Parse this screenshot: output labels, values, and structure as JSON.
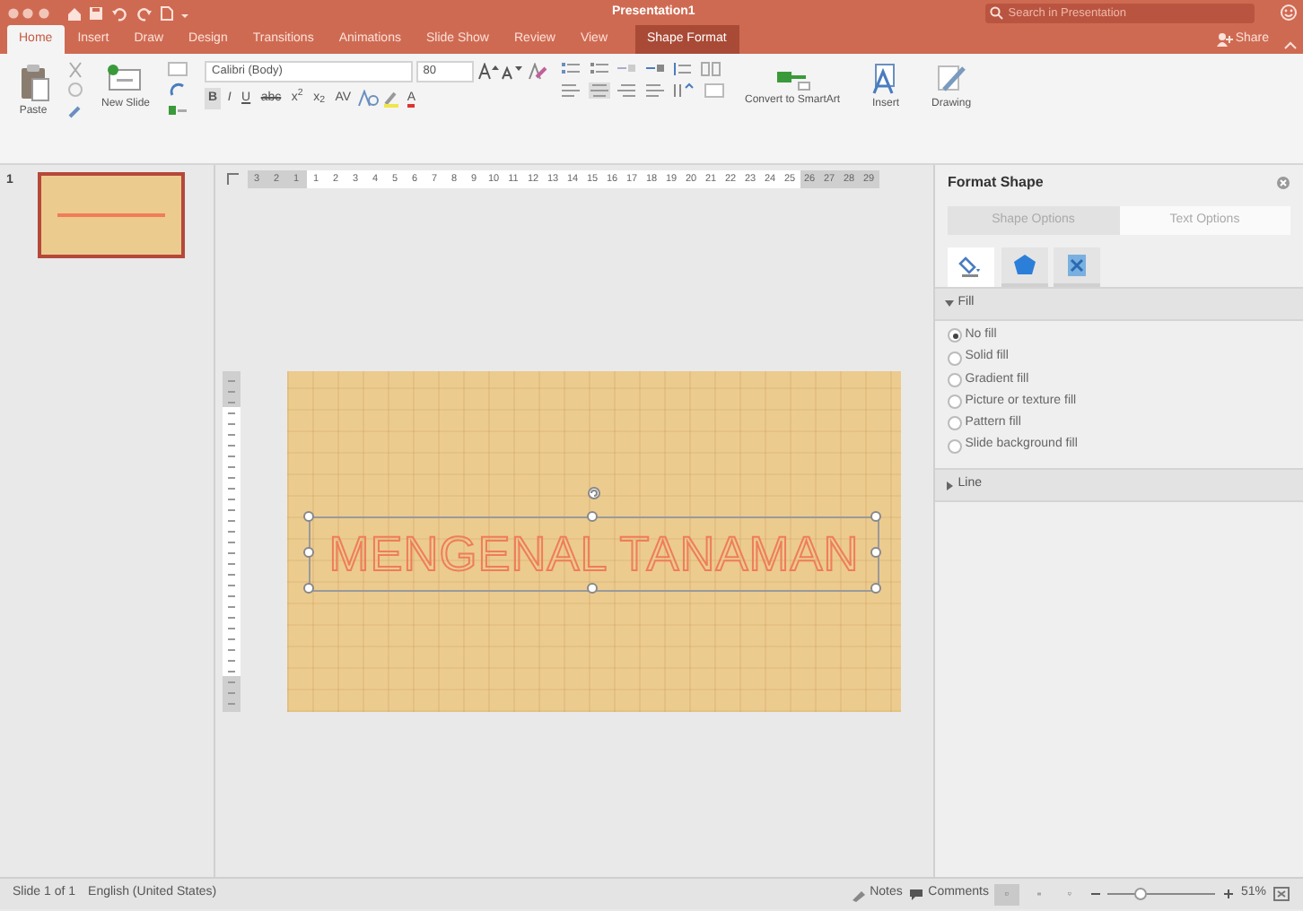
{
  "window": {
    "title": "Presentation1",
    "search_placeholder": "Search in Presentation"
  },
  "tabs": [
    {
      "label": "Home",
      "selected": true,
      "kind": "normal"
    },
    {
      "label": "Insert",
      "selected": false,
      "kind": "normal"
    },
    {
      "label": "Draw",
      "selected": false,
      "kind": "normal"
    },
    {
      "label": "Design",
      "selected": false,
      "kind": "normal"
    },
    {
      "label": "Transitions",
      "selected": false,
      "kind": "normal"
    },
    {
      "label": "Animations",
      "selected": false,
      "kind": "normal"
    },
    {
      "label": "Slide Show",
      "selected": false,
      "kind": "normal"
    },
    {
      "label": "Review",
      "selected": false,
      "kind": "normal"
    },
    {
      "label": "View",
      "selected": false,
      "kind": "normal"
    },
    {
      "label": "Shape Format",
      "selected": false,
      "kind": "contextual"
    }
  ],
  "share": "Share",
  "ribbon": {
    "paste": "Paste",
    "new_slide": "New Slide",
    "font": "Calibri (Body)",
    "font_size": "80",
    "format_buttons": [
      {
        "label": "B",
        "kind": "bold"
      },
      {
        "label": "I",
        "kind": "italic"
      },
      {
        "label": "U",
        "kind": "underline"
      },
      {
        "label": "abc",
        "kind": "strike"
      },
      {
        "label": "x$^{2}$",
        "kind": "plain"
      },
      {
        "label": "x$_{2}$",
        "kind": "plain"
      },
      {
        "label": "AV",
        "kind": "plain"
      }
    ],
    "font_color": "A",
    "convert": "Convert to SmartArt",
    "insert": "Insert",
    "drawing": "Drawing"
  },
  "slides": [
    {
      "number": "1",
      "selected": true
    }
  ],
  "ruler": [
    {
      "label": "3",
      "margin": true
    },
    {
      "label": "2",
      "margin": true
    },
    {
      "label": "1",
      "margin": true
    },
    {
      "label": "1",
      "margin": false
    },
    {
      "label": "2",
      "margin": false
    },
    {
      "label": "3",
      "margin": false
    },
    {
      "label": "4",
      "margin": false
    },
    {
      "label": "5",
      "margin": false
    },
    {
      "label": "6",
      "margin": false
    },
    {
      "label": "7",
      "margin": false
    },
    {
      "label": "8",
      "margin": false
    },
    {
      "label": "9",
      "margin": false
    },
    {
      "label": "10",
      "margin": false
    },
    {
      "label": "11",
      "margin": false
    },
    {
      "label": "12",
      "margin": false
    },
    {
      "label": "13",
      "margin": false
    },
    {
      "label": "14",
      "margin": false
    },
    {
      "label": "15",
      "margin": false
    },
    {
      "label": "16",
      "margin": false
    },
    {
      "label": "17",
      "margin": false
    },
    {
      "label": "18",
      "margin": false
    },
    {
      "label": "19",
      "margin": false
    },
    {
      "label": "20",
      "margin": false
    },
    {
      "label": "21",
      "margin": false
    },
    {
      "label": "22",
      "margin": false
    },
    {
      "label": "23",
      "margin": false
    },
    {
      "label": "24",
      "margin": false
    },
    {
      "label": "25",
      "margin": false
    },
    {
      "label": "26",
      "margin": true
    },
    {
      "label": "27",
      "margin": true
    },
    {
      "label": "28",
      "margin": true
    },
    {
      "label": "29",
      "margin": true
    }
  ],
  "slide": {
    "title": "MENGENAL TANAMAN"
  },
  "format_pane": {
    "title": "Format Shape",
    "tabs": [
      {
        "label": "Shape Options",
        "selected": true
      },
      {
        "label": "Text Options",
        "selected": false
      }
    ],
    "icon_tabs": [
      {
        "kind": "fill",
        "selected": true
      },
      {
        "kind": "effects",
        "selected": false
      },
      {
        "kind": "size",
        "selected": false
      }
    ],
    "sections": [
      {
        "label": "Fill",
        "expanded": true,
        "options": [
          {
            "label": "No fill",
            "selected": true
          },
          {
            "label": "Solid fill",
            "selected": false
          },
          {
            "label": "Gradient fill",
            "selected": false
          },
          {
            "label": "Picture or texture fill",
            "selected": false
          },
          {
            "label": "Pattern fill",
            "selected": false
          },
          {
            "label": "Slide background fill",
            "selected": false
          }
        ]
      },
      {
        "label": "Line",
        "expanded": false
      }
    ]
  },
  "status_bar": {
    "slide": "Slide 1 of 1",
    "language": "English (United States)",
    "notes": "Notes",
    "comments": "Comments",
    "views": [
      {
        "kind": "normal",
        "selected": true
      },
      {
        "kind": "sorter",
        "selected": false
      },
      {
        "kind": "reading",
        "selected": false
      }
    ],
    "zoom": {
      "level": 0.3,
      "reading": "51%"
    }
  }
}
